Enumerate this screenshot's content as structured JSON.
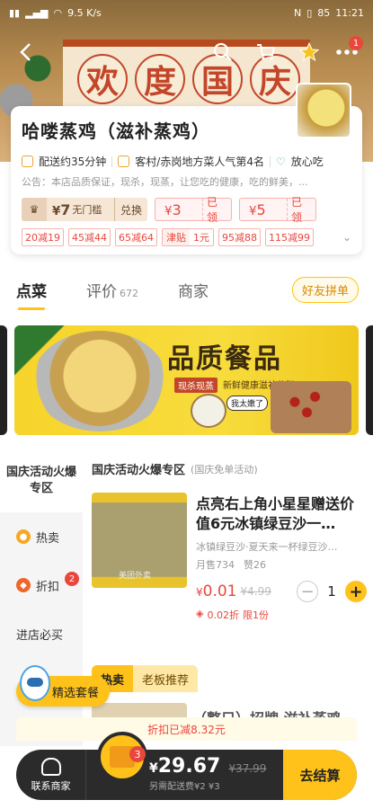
{
  "statusbar": {
    "network": "9.5 K/s",
    "battery": "85",
    "time": "11:21"
  },
  "header": {
    "banner_chars": [
      "欢",
      "度",
      "国",
      "庆"
    ],
    "cart_badge": "1"
  },
  "shop": {
    "name": "哈喽蒸鸡（滋补蒸鸡）",
    "delivery": "配送约35分钟",
    "rank": "客村/赤岗地方菜人气第4名",
    "safe": "放心吃",
    "notice": "公告：本店品质保证，现杀，现蒸，让您吃的健康，吃的鲜美，..."
  },
  "coupons": {
    "vip": {
      "symbol": "¥",
      "amount": "7",
      "label": "无门槛",
      "action": "兑换"
    },
    "c1": {
      "symbol": "¥",
      "amount": "3",
      "status": "已领"
    },
    "c2": {
      "symbol": "¥",
      "amount": "5",
      "status": "已领"
    }
  },
  "promos": [
    "20减19",
    "45减44",
    "65减64",
    "95减88",
    "115减99"
  ],
  "jintie": {
    "label": "津贴",
    "value": "1元"
  },
  "tabs": {
    "order": "点菜",
    "review": "评价",
    "review_count": "672",
    "merchant": "商家",
    "group": "好友拼单"
  },
  "banner": {
    "title": "品质餐品",
    "pill": "现杀现蒸",
    "text": "新鲜健康滋补药膳",
    "bubble": "我太嫩了"
  },
  "categories": {
    "active": "国庆活动火爆专区",
    "hot": "热卖",
    "discount": "折扣",
    "discount_badge": "2",
    "must": "进店必买"
  },
  "section": {
    "title": "国庆活动火爆专区",
    "note": "国庆免单活动"
  },
  "product": {
    "name": "点亮右上角小星星赠送价值6元冰镇绿豆沙一…",
    "desc": "冰镇绿豆沙·夏天来一杯绿豆沙…",
    "sold": "月售734",
    "likes": "赞26",
    "currency": "¥",
    "price": "0.01",
    "old_price": "¥4.99",
    "quantity": "1",
    "discount": "0.02折",
    "limit": "限1份",
    "img_watermark": "美团外卖"
  },
  "section2": {
    "hot": "热卖",
    "boss": "老板推荐",
    "product_name": "（整只）招牌 滋补蒸鸡"
  },
  "set_button": "精选套餐",
  "cart": {
    "discount_strip": "折扣已减8.32元",
    "contact": "联系商家",
    "count": "3",
    "currency": "¥",
    "total": "29.67",
    "old_total": "¥37.99",
    "fee": "另需配送费¥2 ¥3",
    "checkout": "去结算"
  }
}
